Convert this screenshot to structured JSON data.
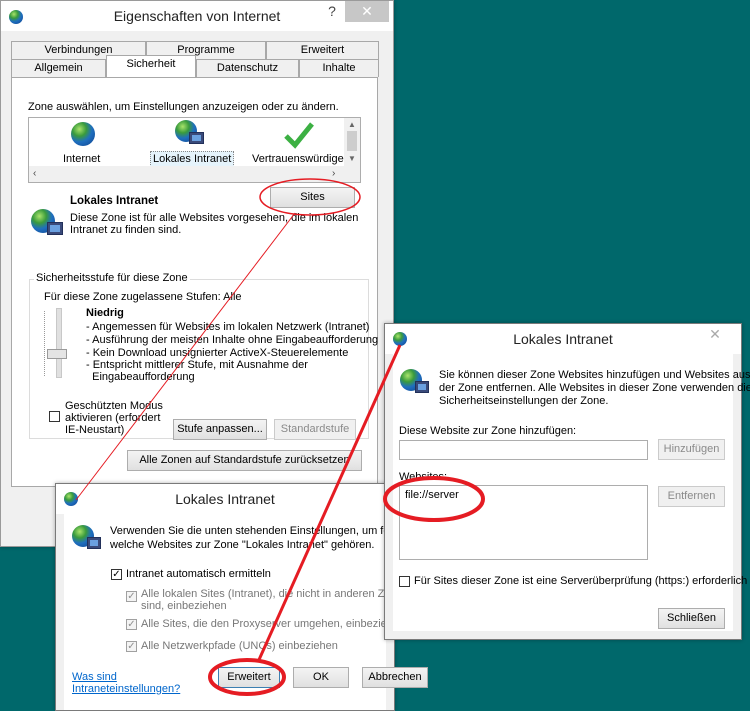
{
  "main": {
    "title": "Eigenschaften von Internet",
    "help": "?",
    "close": "✕",
    "tabs_row1": [
      "Verbindungen",
      "Programme",
      "Erweitert"
    ],
    "tabs_row2": [
      "Allgemein",
      "Sicherheit",
      "Datenschutz",
      "Inhalte"
    ],
    "zone_instruction": "Zone auswählen, um Einstellungen anzuzeigen oder zu ändern.",
    "zones": [
      "Internet",
      "Lokales Intranet",
      "Vertrauenswürdige"
    ],
    "zone_name": "Lokales Intranet",
    "zone_desc1": "Diese Zone ist für alle Websites vorgesehen, die im lokalen",
    "zone_desc2": "Intranet zu finden sind.",
    "sites_button": "Sites",
    "level_group": "Sicherheitsstufe für diese Zone",
    "allowed_levels": "Für diese Zone zugelassene Stufen: Alle",
    "level_name": "Niedrig",
    "level_lines": [
      "- Angemessen für Websites im lokalen Netzwerk (Intranet)",
      "- Ausführung der meisten Inhalte ohne Eingabeaufforderung",
      "- Kein Download unsignierter ActiveX-Steuerelemente",
      "- Entspricht mittlerer Stufe, mit Ausnahme der",
      "  Eingabeaufforderung"
    ],
    "protected_mode": [
      "Geschützten Modus",
      "aktivieren (erfordert",
      "IE-Neustart)"
    ],
    "custom_level_button": "Stufe anpassen...",
    "default_level_button": "Standardstufe",
    "reset_all_button": "Alle Zonen auf Standardstufe zurücksetzen"
  },
  "intranet": {
    "title": "Lokales Intranet",
    "desc1": "Verwenden Sie die unten stehenden Einstellungen, um festzu",
    "desc2": "welche Websites zur Zone \"Lokales Intranet\" gehören.",
    "auto_detect": "Intranet automatisch ermitteln",
    "opt1a": "Alle lokalen Sites (Intranet), die nicht in anderen Zone",
    "opt1b": "sind, einbeziehen",
    "opt2": "Alle Sites, die den Proxyserver umgehen, einbeziehen",
    "opt3": "Alle Netzwerkpfade (UNCs) einbeziehen",
    "link1": "Was sind",
    "link2": "Intraneteinstellungen?",
    "advanced_button": "Erweitert",
    "ok_button": "OK",
    "cancel_button": "Abbrechen"
  },
  "sites": {
    "title": "Lokales Intranet",
    "close": "✕",
    "desc1": "Sie können dieser Zone Websites hinzufügen und Websites aus",
    "desc2": "der Zone entfernen. Alle Websites in dieser Zone verwenden die",
    "desc3": "Sicherheitseinstellungen der Zone.",
    "add_label": "Diese Website zur Zone hinzufügen:",
    "add_value": "",
    "add_button": "Hinzufügen",
    "websites_label": "Websites:",
    "websites": [
      "file://server"
    ],
    "remove_button": "Entfernen",
    "https_check": "Für Sites dieser Zone ist eine Serverüberprüfung (https:) erforderlich",
    "close_button": "Schließen"
  }
}
